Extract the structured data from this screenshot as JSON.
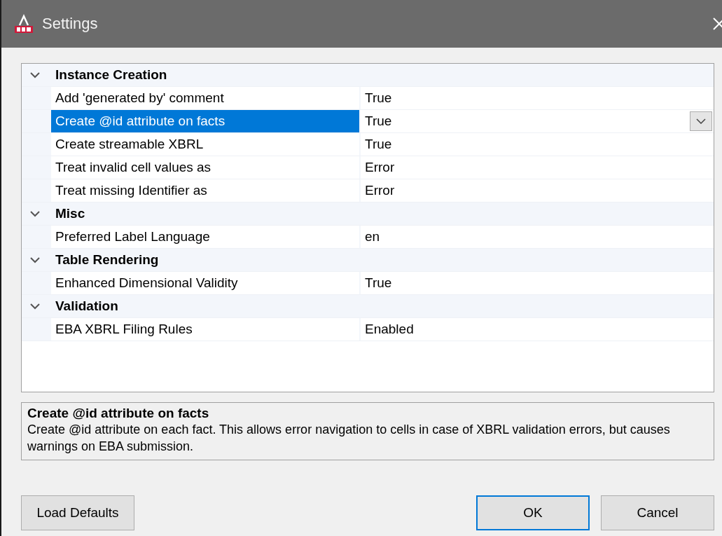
{
  "window": {
    "title": "Settings"
  },
  "categories": [
    {
      "name": "Instance Creation",
      "expanded": true,
      "properties": [
        {
          "name": "Add 'generated by' comment",
          "value": "True",
          "selected": false
        },
        {
          "name": "Create @id attribute on facts",
          "value": "True",
          "selected": true
        },
        {
          "name": "Create streamable XBRL",
          "value": "True",
          "selected": false
        },
        {
          "name": "Treat invalid cell values as",
          "value": "Error",
          "selected": false
        },
        {
          "name": "Treat missing Identifier as",
          "value": "Error",
          "selected": false
        }
      ]
    },
    {
      "name": "Misc",
      "expanded": true,
      "properties": [
        {
          "name": "Preferred Label Language",
          "value": "en",
          "selected": false
        }
      ]
    },
    {
      "name": "Table Rendering",
      "expanded": true,
      "properties": [
        {
          "name": "Enhanced Dimensional Validity",
          "value": "True",
          "selected": false
        }
      ]
    },
    {
      "name": "Validation",
      "expanded": true,
      "properties": [
        {
          "name": "EBA XBRL Filing Rules",
          "value": "Enabled",
          "selected": false
        }
      ]
    }
  ],
  "description": {
    "title": "Create @id attribute on facts",
    "text": "Create @id attribute on each fact. This allows error navigation to cells in case of XBRL validation errors, but causes warnings on EBA submission."
  },
  "buttons": [
    {
      "label": "Load Defaults",
      "default": false
    },
    {
      "label": "OK",
      "default": true
    },
    {
      "label": "Cancel",
      "default": false
    }
  ]
}
